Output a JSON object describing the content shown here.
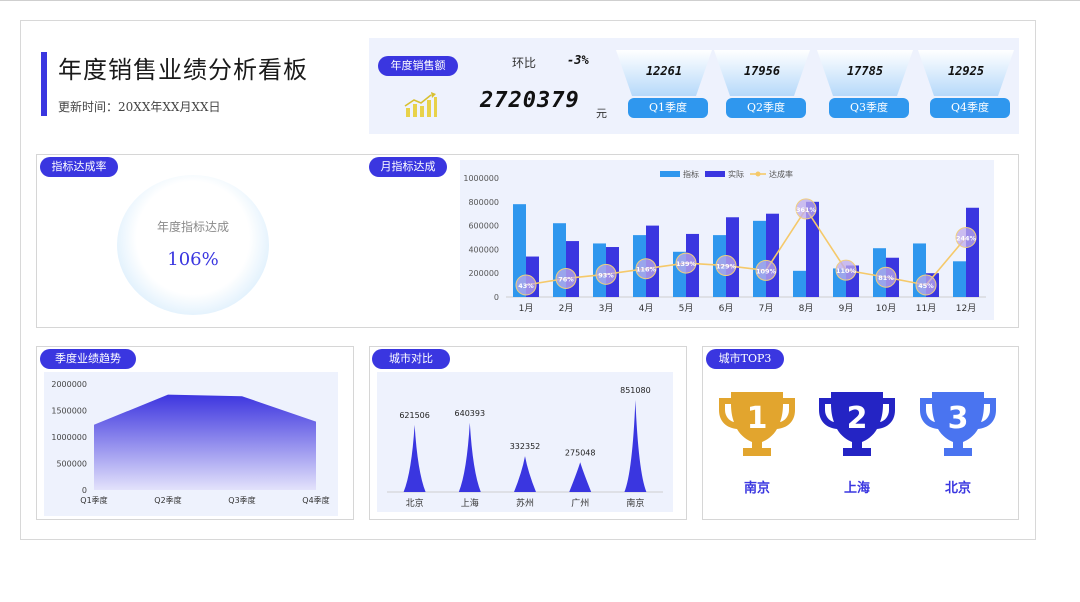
{
  "header": {
    "title": "年度销售业绩分析看板",
    "update_time": "更新时间：20XX年XX月XX日"
  },
  "kpi": {
    "badge": "年度销售额",
    "total": "2720379",
    "unit": "元",
    "mom_label": "环比",
    "mom_value": "-3%",
    "quarters": [
      {
        "label": "Q1季度",
        "value": "12261"
      },
      {
        "label": "Q2季度",
        "value": "17956"
      },
      {
        "label": "Q3季度",
        "value": "17785"
      },
      {
        "label": "Q4季度",
        "value": "12925"
      }
    ]
  },
  "panels": {
    "rate_title": "指标达成率",
    "monthly_title": "月指标达成",
    "quarter_title": "季度业绩趋势",
    "city_title": "城市对比",
    "top3_title": "城市TOP3"
  },
  "gauge": {
    "label": "年度指标达成",
    "value": "106%"
  },
  "top3": {
    "cities": [
      "南京",
      "上海",
      "北京"
    ],
    "ranks": [
      "1",
      "2",
      "3"
    ],
    "colors": [
      "#e2a52e",
      "#2424c4",
      "#4a74f0"
    ]
  },
  "colors": {
    "accent": "#3a36e0",
    "target": "#2f97ee",
    "actual": "#3a36e0",
    "rate_line": "#f5c96a"
  },
  "chart_data": [
    {
      "type": "bar",
      "legend": [
        "指标",
        "实际",
        "达成率"
      ],
      "categories": [
        "1月",
        "2月",
        "3月",
        "4月",
        "5月",
        "6月",
        "7月",
        "8月",
        "9月",
        "10月",
        "11月",
        "12月"
      ],
      "series": [
        {
          "name": "指标",
          "values": [
            780000,
            620000,
            450000,
            520000,
            380000,
            520000,
            640000,
            220000,
            240000,
            410000,
            450000,
            300000
          ]
        },
        {
          "name": "实际",
          "values": [
            340000,
            470000,
            420000,
            600000,
            530000,
            670000,
            700000,
            800000,
            265000,
            330000,
            200000,
            750000
          ]
        }
      ],
      "rate": {
        "name": "达成率",
        "values": [
          43,
          76,
          93,
          116,
          139,
          129,
          109,
          361,
          110,
          81,
          45,
          244
        ],
        "labels": [
          "43%",
          "76%",
          "93%",
          "116%",
          "139%",
          "129%",
          "109%",
          "361%",
          "110%",
          "81%",
          "45%",
          "244%"
        ]
      },
      "yticks": [
        "1000000",
        "800000",
        "600000",
        "400000",
        "200000",
        "0"
      ],
      "ylim": [
        0,
        1000000
      ]
    },
    {
      "type": "area",
      "categories": [
        "Q1季度",
        "Q2季度",
        "Q3季度",
        "Q4季度"
      ],
      "values": [
        1230000,
        1800000,
        1770000,
        1290000
      ],
      "yticks": [
        "2000000",
        "1500000",
        "1000000",
        "500000",
        "0"
      ],
      "ylim": [
        0,
        2000000
      ]
    },
    {
      "type": "bar",
      "categories": [
        "北京",
        "上海",
        "苏州",
        "广州",
        "南京"
      ],
      "values": [
        621506,
        640393,
        332352,
        275048,
        851080
      ],
      "labels": [
        "621506",
        "640393",
        "332352",
        "275048",
        "851080"
      ]
    }
  ]
}
